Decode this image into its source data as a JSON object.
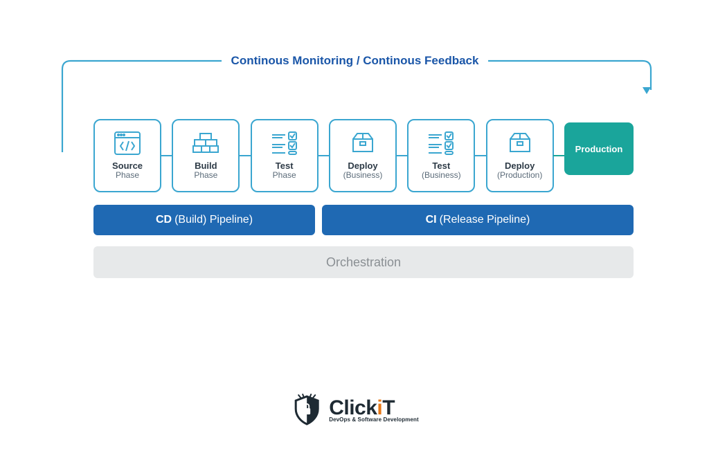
{
  "title": "Continous Monitoring / Continous Feedback",
  "stages": [
    {
      "label": "Source",
      "sub": "Phase",
      "icon": "code"
    },
    {
      "label": "Build",
      "sub": "Phase",
      "icon": "bricks"
    },
    {
      "label": "Test",
      "sub": "Phase",
      "icon": "checklist"
    },
    {
      "label": "Deploy",
      "sub": "(Business)",
      "icon": "package"
    },
    {
      "label": "Test",
      "sub": "(Business)",
      "icon": "checklist"
    },
    {
      "label": "Deploy",
      "sub": "(Production)",
      "icon": "package"
    }
  ],
  "production": "Production",
  "pipelines": {
    "cd_bold": "CD",
    "cd_rest": "(Build) Pipeline)",
    "ci_bold": "CI",
    "ci_rest": "(Release Pipeline)"
  },
  "orchestration": "Orchestration",
  "logo": {
    "name": "ClickiT",
    "tagline": "DevOps & Software Development"
  },
  "colors": {
    "blue": "#1f69b3",
    "cyan": "#3aa6d0",
    "teal": "#1aa59b",
    "gray": "#e7e9ea"
  }
}
